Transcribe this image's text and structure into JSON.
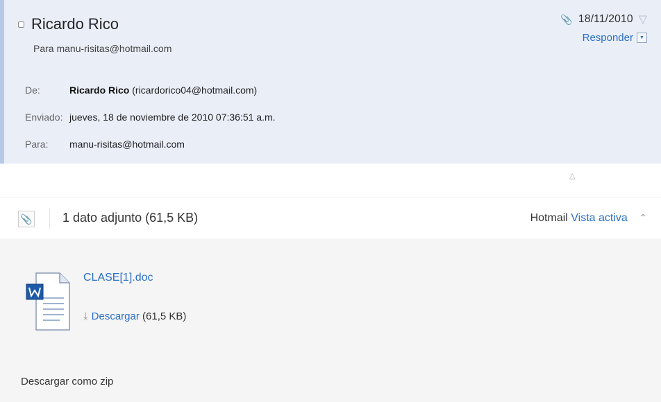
{
  "message": {
    "sender_name": "Ricardo Rico",
    "to_line": "Para manu-risitas@hotmail.com",
    "date": "18/11/2010",
    "reply_label": "Responder",
    "details": {
      "from_label": "De:",
      "from_name": "Ricardo Rico",
      "from_email": " (ricardorico04@hotmail.com)",
      "sent_label": "Enviado:",
      "sent_value": "jueves, 18 de noviembre de 2010 07:36:51 a.m.",
      "to_label": "Para:",
      "to_value": "manu-risitas@hotmail.com"
    }
  },
  "attachments": {
    "summary": "1 dato adjunto (61,5 KB)",
    "hotmail_label": "Hotmail",
    "active_view_label": "Vista activa",
    "file": {
      "name": "CLASE[1].doc",
      "download_label": "Descargar",
      "size": " (61,5 KB)",
      "icon": "word-document-icon"
    },
    "zip_label": "Descargar como zip"
  },
  "colors": {
    "header_bg": "#e9eef7",
    "link": "#2b6fc4",
    "word_blue": "#1f5aa8"
  }
}
